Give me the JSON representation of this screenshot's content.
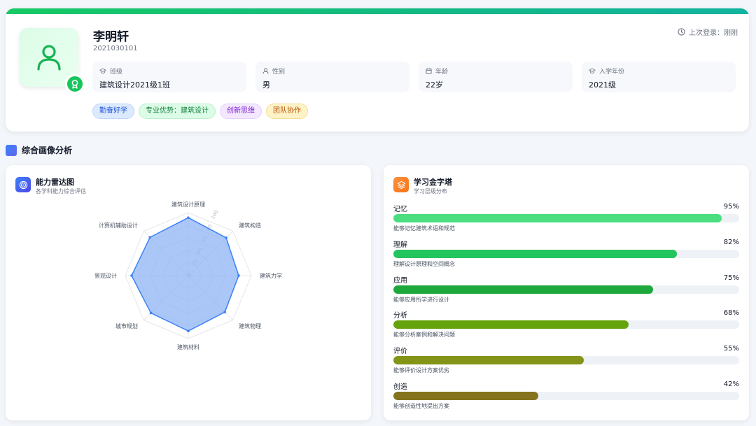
{
  "profile": {
    "name": "李明轩",
    "student_id": "2021030101",
    "last_login": "上次登录：刚刚",
    "info": [
      {
        "label": "班级",
        "value": "建筑设计2021级1班",
        "icon": "graduation-cap-icon"
      },
      {
        "label": "性别",
        "value": "男",
        "icon": "user-icon"
      },
      {
        "label": "年龄",
        "value": "22岁",
        "icon": "calendar-icon"
      },
      {
        "label": "入学年份",
        "value": "2021级",
        "icon": "graduation-cap-icon"
      }
    ],
    "tags": [
      "勤奋好学",
      "专业优势：建筑设计",
      "创新思维",
      "团队协作"
    ]
  },
  "section": {
    "title": "综合画像分析"
  },
  "radar": {
    "title": "能力雷达图",
    "subtitle": "各学科能力综合评估",
    "ticks": [
      "0",
      "20",
      "40",
      "60",
      "80",
      "100"
    ],
    "fill_color": "#8fb4f5",
    "stroke_color": "#3b82f6"
  },
  "chart_data": {
    "type": "radar",
    "categories": [
      "建筑设计原理",
      "建筑构造",
      "建筑力学",
      "建筑物理",
      "建筑材料",
      "城市规划",
      "景观设计",
      "计算机辅助设计"
    ],
    "values": [
      92,
      85,
      80,
      82,
      88,
      84,
      90,
      86
    ],
    "ylim": [
      0,
      100
    ]
  },
  "pyramid": {
    "title": "学习金字塔",
    "subtitle": "学习层级分布",
    "levels": [
      {
        "label": "记忆",
        "percent": "95%",
        "value": 95,
        "desc": "能够记忆建筑术语和规范",
        "color": "#4ade80"
      },
      {
        "label": "理解",
        "percent": "82%",
        "value": 82,
        "desc": "理解设计原理和空间概念",
        "color": "#22c55e"
      },
      {
        "label": "应用",
        "percent": "75%",
        "value": 75,
        "desc": "能够应用所学进行设计",
        "color": "#1fa83c"
      },
      {
        "label": "分析",
        "percent": "68%",
        "value": 68,
        "desc": "能够分析案例和解决问题",
        "color": "#65a30d"
      },
      {
        "label": "评价",
        "percent": "55%",
        "value": 55,
        "desc": "能够评价设计方案优劣",
        "color": "#839417"
      },
      {
        "label": "创造",
        "percent": "42%",
        "value": 42,
        "desc": "能够创造性地提出方案",
        "color": "#85731d"
      }
    ]
  }
}
